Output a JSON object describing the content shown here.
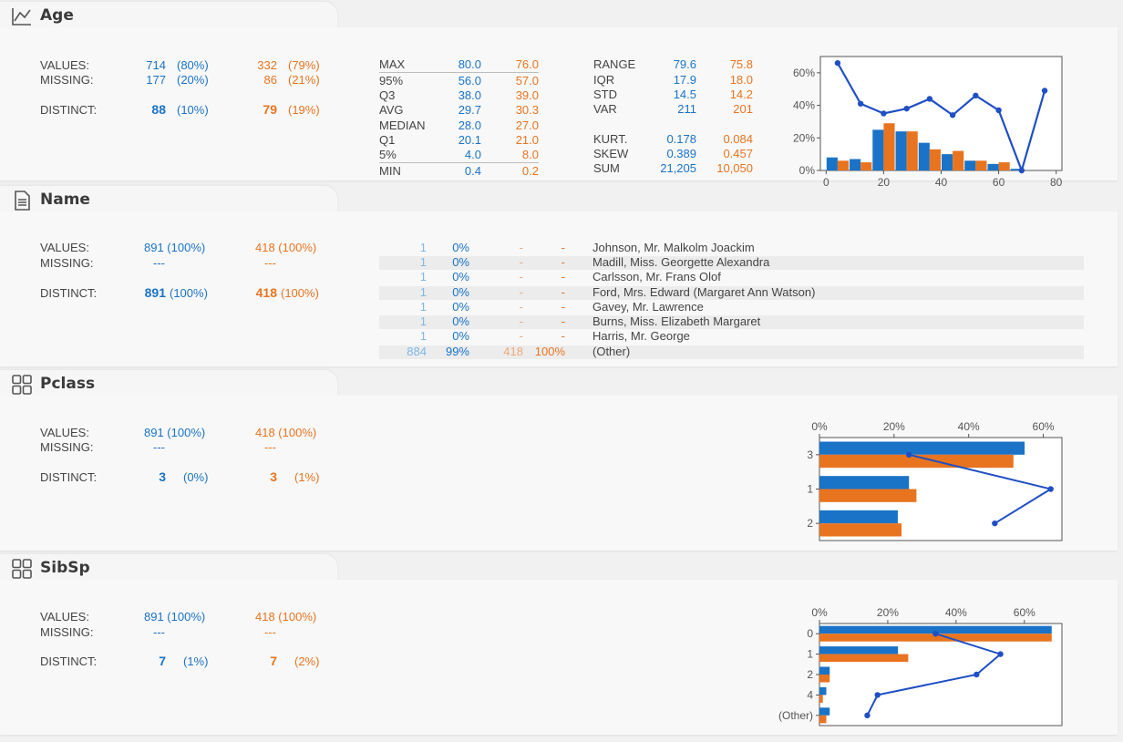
{
  "colors": {
    "series_a": "#1a73c7",
    "series_b": "#e8741f",
    "line": "#1f4fc4"
  },
  "age": {
    "title": "Age",
    "icon": "line-chart-icon",
    "values_label": "VALUES:",
    "missing_label": "MISSING:",
    "distinct_label": "DISTINCT:",
    "a": {
      "values": "714",
      "values_pct": "(80%)",
      "missing": "177",
      "missing_pct": "(20%)",
      "distinct": "88",
      "distinct_pct": "(10%)"
    },
    "b": {
      "values": "332",
      "values_pct": "(79%)",
      "missing": "86",
      "missing_pct": "(21%)",
      "distinct": "79",
      "distinct_pct": "(19%)"
    },
    "quantiles": [
      {
        "label": "MAX",
        "a": "80.0",
        "b": "76.0"
      },
      {
        "label": "95%",
        "a": "56.0",
        "b": "57.0"
      },
      {
        "label": "Q3",
        "a": "38.0",
        "b": "39.0"
      },
      {
        "label": "AVG",
        "a": "29.7",
        "b": "30.3"
      },
      {
        "label": "MEDIAN",
        "a": "28.0",
        "b": "27.0"
      },
      {
        "label": "Q1",
        "a": "20.1",
        "b": "21.0"
      },
      {
        "label": "5%",
        "a": "4.0",
        "b": "8.0"
      },
      {
        "label": "MIN",
        "a": "0.4",
        "b": "0.2"
      }
    ],
    "stats1": [
      {
        "label": "RANGE",
        "a": "79.6",
        "b": "75.8"
      },
      {
        "label": "IQR",
        "a": "17.9",
        "b": "18.0"
      },
      {
        "label": "STD",
        "a": "14.5",
        "b": "14.2"
      },
      {
        "label": "VAR",
        "a": "211",
        "b": "201"
      }
    ],
    "stats2": [
      {
        "label": "KURT.",
        "a": "0.178",
        "b": "0.084"
      },
      {
        "label": "SKEW",
        "a": "0.389",
        "b": "0.457"
      },
      {
        "label": "SUM",
        "a": "21,205",
        "b": "10,050"
      }
    ]
  },
  "name": {
    "title": "Name",
    "icon": "document-icon",
    "values_label": "VALUES:",
    "missing_label": "MISSING:",
    "distinct_label": "DISTINCT:",
    "a": {
      "values": "891 (100%)",
      "missing": "---",
      "distinct": "891",
      "distinct_pct": "(100%)"
    },
    "b": {
      "values": "418 (100%)",
      "missing": "---",
      "distinct": "418",
      "distinct_pct": "(100%)"
    },
    "rows": [
      {
        "a_count": "1",
        "a_pct": "0%",
        "b_count": "-",
        "b_pct": "-",
        "label": "Johnson, Mr. Malkolm Joackim"
      },
      {
        "a_count": "1",
        "a_pct": "0%",
        "b_count": "-",
        "b_pct": "-",
        "label": "Madill, Miss. Georgette Alexandra"
      },
      {
        "a_count": "1",
        "a_pct": "0%",
        "b_count": "-",
        "b_pct": "-",
        "label": "Carlsson, Mr. Frans Olof"
      },
      {
        "a_count": "1",
        "a_pct": "0%",
        "b_count": "-",
        "b_pct": "-",
        "label": "Ford, Mrs. Edward (Margaret Ann Watson)"
      },
      {
        "a_count": "1",
        "a_pct": "0%",
        "b_count": "-",
        "b_pct": "-",
        "label": "Gavey, Mr. Lawrence"
      },
      {
        "a_count": "1",
        "a_pct": "0%",
        "b_count": "-",
        "b_pct": "-",
        "label": "Burns, Miss. Elizabeth Margaret"
      },
      {
        "a_count": "1",
        "a_pct": "0%",
        "b_count": "-",
        "b_pct": "-",
        "label": "Harris, Mr. George"
      },
      {
        "a_count": "884",
        "a_pct": "99%",
        "b_count": "418",
        "b_pct": "100%",
        "label": "(Other)"
      }
    ]
  },
  "pclass": {
    "title": "Pclass",
    "icon": "grid-icon",
    "values_label": "VALUES:",
    "missing_label": "MISSING:",
    "distinct_label": "DISTINCT:",
    "a": {
      "values": "891 (100%)",
      "missing": "---",
      "distinct": "3",
      "distinct_pct": "(0%)"
    },
    "b": {
      "values": "418 (100%)",
      "missing": "---",
      "distinct": "3",
      "distinct_pct": "(1%)"
    }
  },
  "sibsp": {
    "title": "SibSp",
    "icon": "grid-icon",
    "values_label": "VALUES:",
    "missing_label": "MISSING:",
    "distinct_label": "DISTINCT:",
    "a": {
      "values": "891 (100%)",
      "missing": "---",
      "distinct": "7",
      "distinct_pct": "(1%)"
    },
    "b": {
      "values": "418 (100%)",
      "missing": "---",
      "distinct": "7",
      "distinct_pct": "(2%)"
    }
  },
  "chart_data": [
    {
      "type": "bar",
      "title": "",
      "x_ticks": [
        "0",
        "20",
        "40",
        "60",
        "80"
      ],
      "y_ticks": [
        "0%",
        "20%",
        "40%",
        "60%"
      ],
      "xlim": [
        -2,
        82
      ],
      "ylim": [
        0,
        70
      ],
      "bin_centers": [
        4,
        12,
        20,
        28,
        36,
        44,
        52,
        60,
        68,
        76
      ],
      "series": [
        {
          "values": [
            8,
            7,
            25,
            24,
            17,
            10,
            6,
            4,
            1,
            0
          ]
        },
        {
          "values": [
            6,
            5,
            29,
            24,
            13,
            12,
            6,
            5,
            0,
            0
          ]
        }
      ],
      "line": [
        {
          "x": 4,
          "y": 66
        },
        {
          "x": 12,
          "y": 41
        },
        {
          "x": 20,
          "y": 35
        },
        {
          "x": 28,
          "y": 38
        },
        {
          "x": 36,
          "y": 44
        },
        {
          "x": 44,
          "y": 34
        },
        {
          "x": 52,
          "y": 46
        },
        {
          "x": 60,
          "y": 37
        },
        {
          "x": 68,
          "y": 0
        },
        {
          "x": 76,
          "y": 49
        }
      ]
    },
    {
      "type": "bar",
      "title": "",
      "orientation": "horizontal",
      "categories": [
        "3",
        "1",
        "2"
      ],
      "x_ticks": [
        "0%",
        "20%",
        "40%",
        "60%"
      ],
      "xlim": [
        0,
        65
      ],
      "series": [
        {
          "values": [
            55,
            24,
            21
          ]
        },
        {
          "values": [
            52,
            26,
            22
          ]
        }
      ],
      "line": [
        24,
        62,
        47
      ]
    },
    {
      "type": "bar",
      "title": "",
      "orientation": "horizontal",
      "categories": [
        "0",
        "1",
        "2",
        "4",
        "(Other)"
      ],
      "x_ticks": [
        "0%",
        "20%",
        "40%",
        "60%"
      ],
      "xlim": [
        0,
        71
      ],
      "series": [
        {
          "values": [
            68,
            23,
            3,
            2,
            3
          ]
        },
        {
          "values": [
            68,
            26,
            3,
            1,
            2
          ]
        }
      ],
      "line": [
        34,
        53,
        46,
        17,
        14
      ]
    }
  ]
}
